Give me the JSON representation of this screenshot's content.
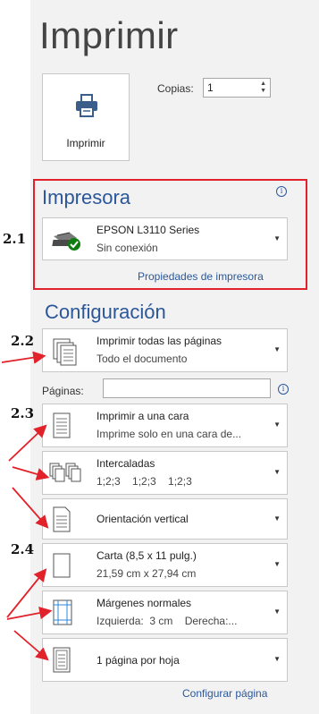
{
  "title": "Imprimir",
  "print_button": {
    "label": "Imprimir"
  },
  "copies": {
    "label": "Copias:",
    "value": "1"
  },
  "printer": {
    "heading": "Impresora",
    "name": "EPSON L3110 Series",
    "status": "Sin conexión",
    "properties_link": "Propiedades de impresora"
  },
  "settings": {
    "heading": "Configuración",
    "pages_label": "Páginas:",
    "print_what": {
      "title": "Imprimir todas las páginas",
      "subtitle": "Todo el documento"
    },
    "sides": {
      "title": "Imprimir a una cara",
      "subtitle": "Imprime solo en una cara de..."
    },
    "collation": {
      "title": "Intercaladas",
      "subtitle": "1;2;3    1;2;3    1;2;3"
    },
    "orientation": {
      "title": "Orientación vertical"
    },
    "paper": {
      "title": "Carta (8,5 x 11 pulg.)",
      "subtitle": "21,59 cm x 27,94 cm"
    },
    "margins": {
      "title": "Márgenes normales",
      "subtitle": "Izquierda:  3 cm    Derecha:..."
    },
    "per_sheet": {
      "title": "1 página por hoja"
    },
    "page_setup_link": "Configurar página"
  },
  "annotations": {
    "s1": "2.1",
    "s2": "2.2",
    "s3": "2.3",
    "s4": "2.4"
  },
  "colors": {
    "accent": "#2b579a",
    "highlight_red": "#e2222a"
  }
}
